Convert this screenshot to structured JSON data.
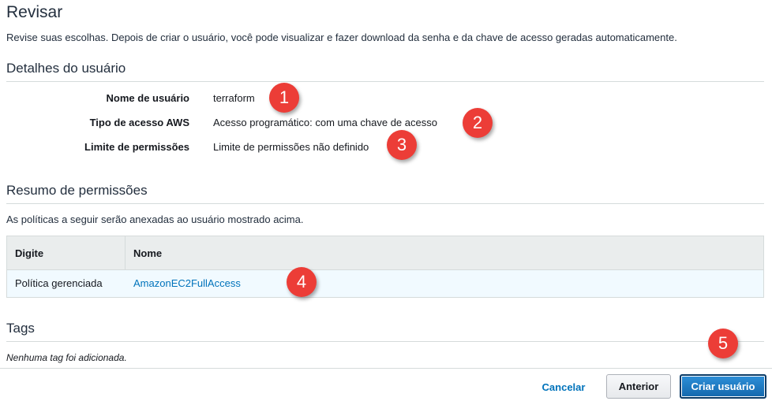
{
  "page": {
    "title": "Revisar",
    "description": "Revise suas escolhas. Depois de criar o usuário, você pode visualizar e fazer download da senha e da chave de acesso geradas automaticamente."
  },
  "user_details": {
    "section_title": "Detalhes do usuário",
    "rows": [
      {
        "label": "Nome de usuário",
        "value": "terraform"
      },
      {
        "label": "Tipo de acesso AWS",
        "value": "Acesso programático: com uma chave de acesso"
      },
      {
        "label": "Limite de permissões",
        "value": "Limite de permissões não definido"
      }
    ]
  },
  "permissions": {
    "section_title": "Resumo de permissões",
    "description": "As políticas a seguir serão anexadas ao usuário mostrado acima.",
    "columns": [
      "Digite",
      "Nome"
    ],
    "rows": [
      {
        "type": "Política gerenciada",
        "name": "AmazonEC2FullAccess"
      }
    ]
  },
  "tags": {
    "section_title": "Tags",
    "empty_text": "Nenhuma tag foi adicionada."
  },
  "footer": {
    "cancel_label": "Cancelar",
    "previous_label": "Anterior",
    "create_label": "Criar usuário"
  },
  "markers": [
    "1",
    "2",
    "3",
    "4",
    "5"
  ],
  "colors": {
    "marker": "#ec3d37",
    "link": "#0073bb",
    "primary_button": "#1a74bf",
    "table_header": "#eaeded",
    "table_row_highlight": "#f1faff"
  }
}
